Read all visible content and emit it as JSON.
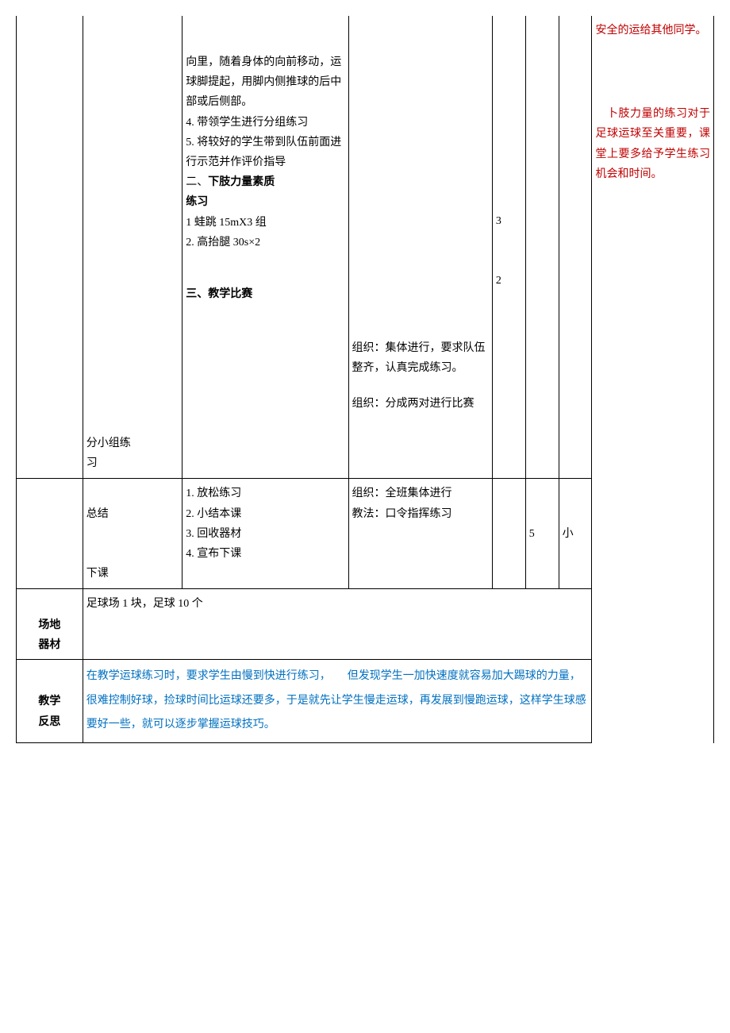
{
  "row1": {
    "col2": "分小组练\n习",
    "col3_p1": "向里，随着身体的向前移动，运球脚提起，用脚内侧推球的后中部或后侧部。",
    "col3_p2": "4. 带领学生进行分组练习",
    "col3_p3": "5. 将较好的学生带到队伍前面进行示范并作评价指导",
    "col3_p4_pre": "二、",
    "col3_p4_bold": "下肢力量素质\n练习",
    "col3_p5": "1 蛙跳 15mX3 组",
    "col3_p6": "2. 高抬腿 30s×2",
    "col3_p7_bold": "三、教学比赛",
    "col4_p1": "组织：集体进行，要求队伍整齐，认真完成练习。",
    "col4_p2": "组织：分成两对进行比赛",
    "col5_a": "3",
    "col5_b": "2",
    "col8_p1": "安全的运给其他同学。",
    "col8_p2": "　卜肢力量的练习对于足球运球至关重要，课堂上要多给予学生练习机会和时间。"
  },
  "row2": {
    "col2": "总结\n\n\n下课",
    "col3_p1": "1. 放松练习",
    "col3_p2": "2. 小结本课",
    "col3_p3": "3. 回收器材",
    "col3_p4": "4. 宣布下课",
    "col4_p1": "组织：全班集体进行",
    "col4_p2": "教法：口令指挥练习",
    "col6": "5",
    "col7": "小"
  },
  "row3": {
    "label": "场地\n器材",
    "content": "足球场 1 块，足球 10 个"
  },
  "row4": {
    "label": "教学\n反思",
    "content": "在教学运球练习时，要求学生由慢到快进行练习，　　但发现学生一加快速度就容易加大踢球的力量，很难控制好球，捡球时间比运球还要多，于是就先让学生慢走运球，再发展到慢跑运球，这样学生球感要好一些，就可以逐步掌握运球技巧。"
  }
}
